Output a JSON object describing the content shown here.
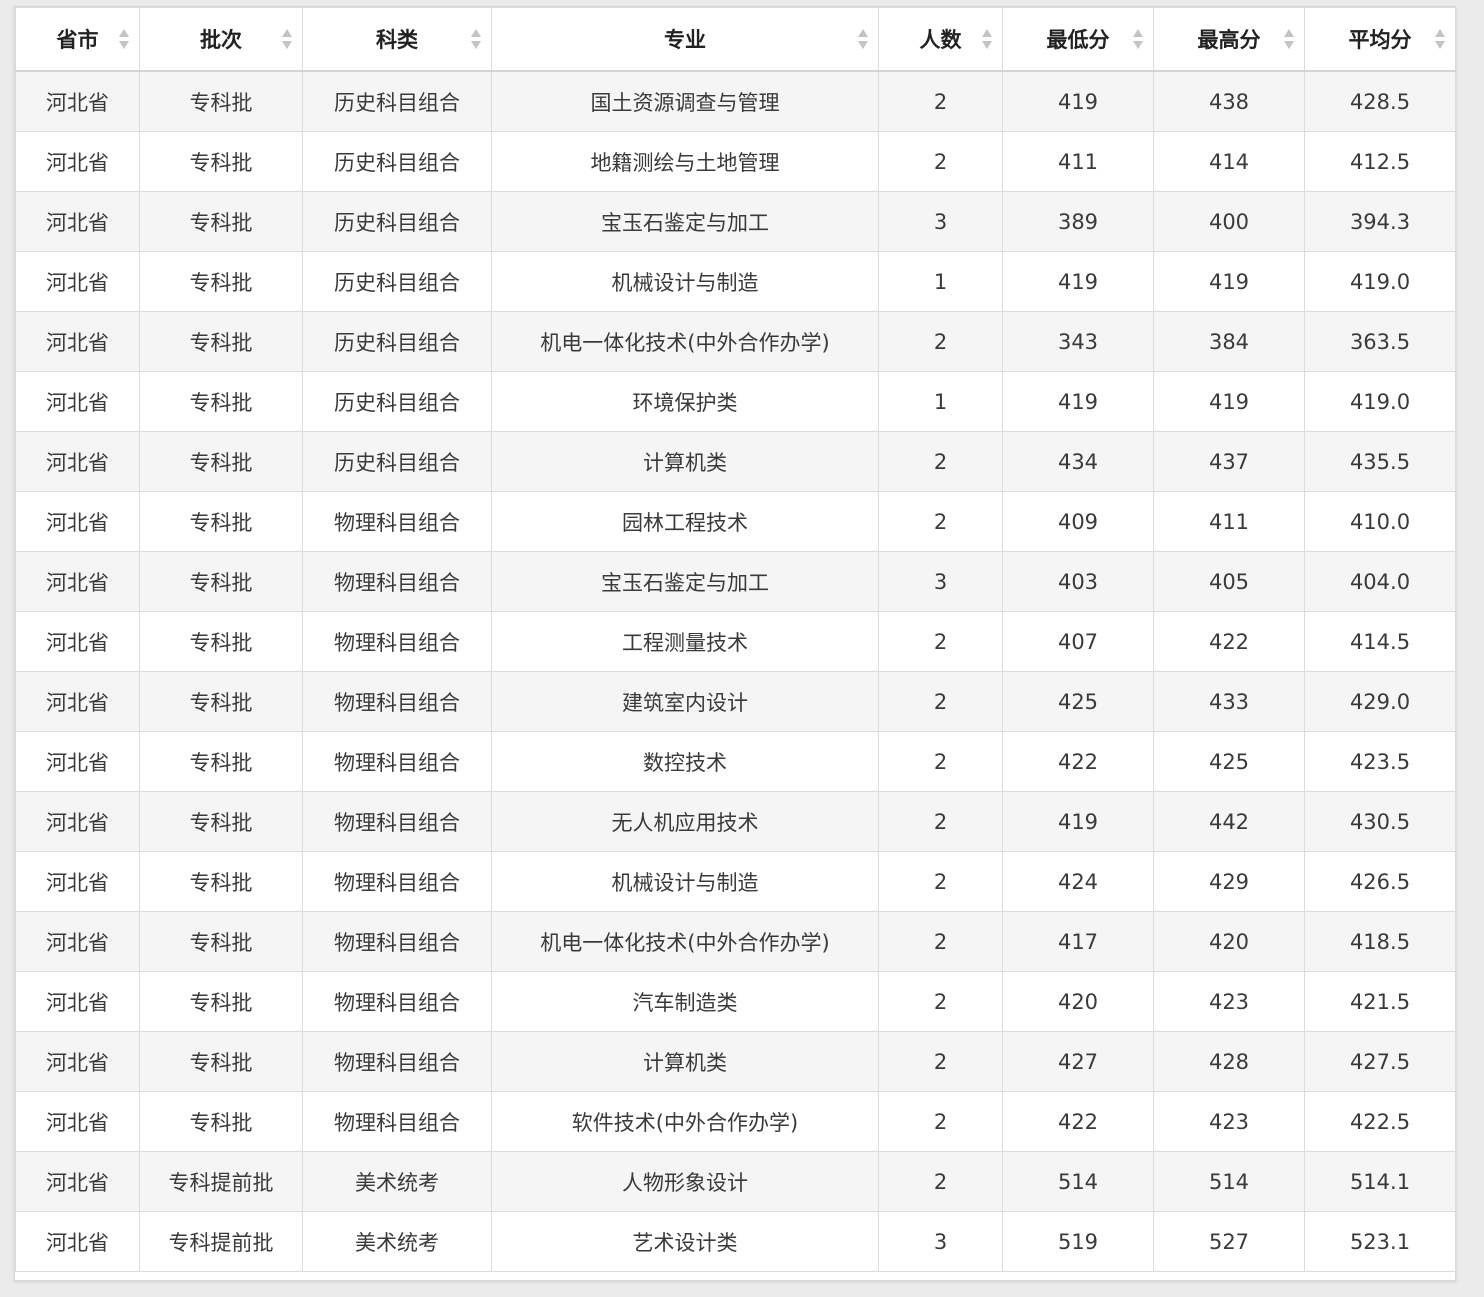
{
  "table": {
    "columns": [
      "省市",
      "批次",
      "科类",
      "专业",
      "人数",
      "最低分",
      "最高分",
      "平均分"
    ],
    "rows": [
      [
        "河北省",
        "专科批",
        "历史科目组合",
        "国土资源调查与管理",
        "2",
        "419",
        "438",
        "428.5"
      ],
      [
        "河北省",
        "专科批",
        "历史科目组合",
        "地籍测绘与土地管理",
        "2",
        "411",
        "414",
        "412.5"
      ],
      [
        "河北省",
        "专科批",
        "历史科目组合",
        "宝玉石鉴定与加工",
        "3",
        "389",
        "400",
        "394.3"
      ],
      [
        "河北省",
        "专科批",
        "历史科目组合",
        "机械设计与制造",
        "1",
        "419",
        "419",
        "419.0"
      ],
      [
        "河北省",
        "专科批",
        "历史科目组合",
        "机电一体化技术(中外合作办学)",
        "2",
        "343",
        "384",
        "363.5"
      ],
      [
        "河北省",
        "专科批",
        "历史科目组合",
        "环境保护类",
        "1",
        "419",
        "419",
        "419.0"
      ],
      [
        "河北省",
        "专科批",
        "历史科目组合",
        "计算机类",
        "2",
        "434",
        "437",
        "435.5"
      ],
      [
        "河北省",
        "专科批",
        "物理科目组合",
        "园林工程技术",
        "2",
        "409",
        "411",
        "410.0"
      ],
      [
        "河北省",
        "专科批",
        "物理科目组合",
        "宝玉石鉴定与加工",
        "3",
        "403",
        "405",
        "404.0"
      ],
      [
        "河北省",
        "专科批",
        "物理科目组合",
        "工程测量技术",
        "2",
        "407",
        "422",
        "414.5"
      ],
      [
        "河北省",
        "专科批",
        "物理科目组合",
        "建筑室内设计",
        "2",
        "425",
        "433",
        "429.0"
      ],
      [
        "河北省",
        "专科批",
        "物理科目组合",
        "数控技术",
        "2",
        "422",
        "425",
        "423.5"
      ],
      [
        "河北省",
        "专科批",
        "物理科目组合",
        "无人机应用技术",
        "2",
        "419",
        "442",
        "430.5"
      ],
      [
        "河北省",
        "专科批",
        "物理科目组合",
        "机械设计与制造",
        "2",
        "424",
        "429",
        "426.5"
      ],
      [
        "河北省",
        "专科批",
        "物理科目组合",
        "机电一体化技术(中外合作办学)",
        "2",
        "417",
        "420",
        "418.5"
      ],
      [
        "河北省",
        "专科批",
        "物理科目组合",
        "汽车制造类",
        "2",
        "420",
        "423",
        "421.5"
      ],
      [
        "河北省",
        "专科批",
        "物理科目组合",
        "计算机类",
        "2",
        "427",
        "428",
        "427.5"
      ],
      [
        "河北省",
        "专科批",
        "物理科目组合",
        "软件技术(中外合作办学)",
        "2",
        "422",
        "423",
        "422.5"
      ],
      [
        "河北省",
        "专科提前批",
        "美术统考",
        "人物形象设计",
        "2",
        "514",
        "514",
        "514.1"
      ],
      [
        "河北省",
        "专科提前批",
        "美术统考",
        "艺术设计类",
        "3",
        "519",
        "527",
        "523.1"
      ]
    ]
  }
}
